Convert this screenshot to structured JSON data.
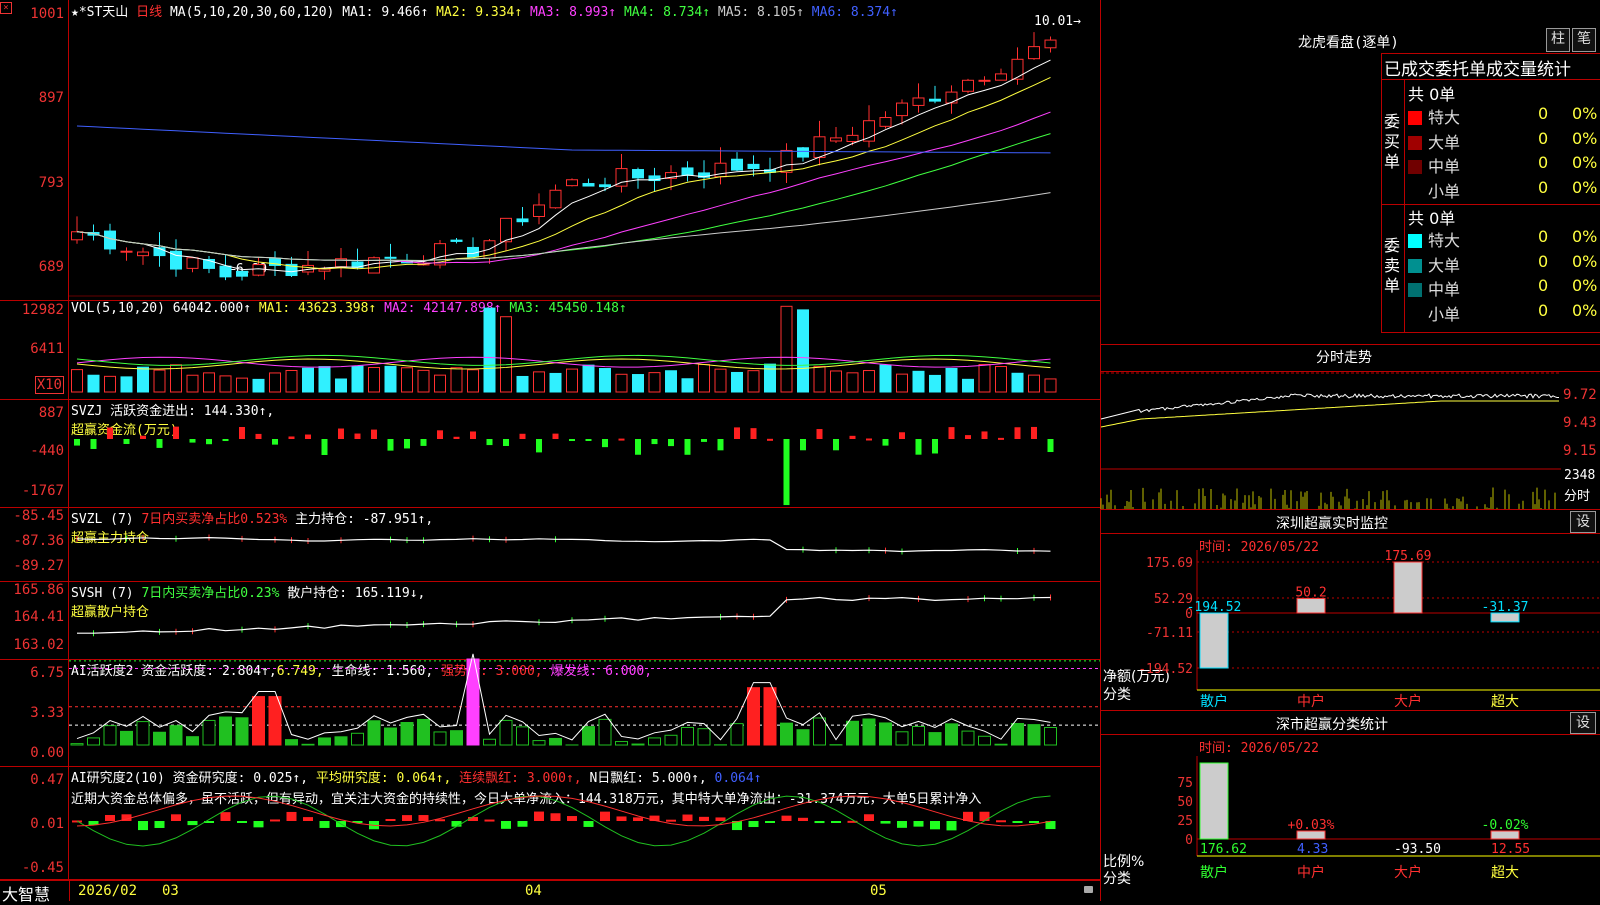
{
  "main": {
    "title_prefix": "★*ST天山",
    "period": "日线",
    "ma_label": "MA(5,10,20,30,60,120)",
    "ma": [
      {
        "label": "MA1: 9.466↑",
        "color": "#ffffff"
      },
      {
        "label": "MA2: 9.334↑",
        "color": "#ffff40"
      },
      {
        "label": "MA3: 8.993↑",
        "color": "#ff40ff"
      },
      {
        "label": "MA4: 8.734↑",
        "color": "#40ff40"
      },
      {
        "label": "MA5: 8.105↑",
        "color": "#cccccc"
      },
      {
        "label": "MA6: 8.374↑",
        "color": "#4060ff"
      }
    ],
    "y_ticks": [
      "1001",
      "897",
      "793",
      "689"
    ],
    "high_note": "10.01→",
    "low_note": "←6.89"
  },
  "vol": {
    "title": "VOL(5,10,20)",
    "value": "64042.000↑",
    "ma1": "MA1: 43623.398↑",
    "ma2": "MA2: 42147.898↑",
    "ma3": "MA3: 45450.148↑",
    "y_ticks": [
      "12982",
      "6411"
    ],
    "unit": "X10"
  },
  "svzj": {
    "title": "SVZJ  活跃资金进出: 144.330↑,",
    "subtitle": "超赢资金流(万元)",
    "y_ticks": [
      "887",
      "-440",
      "-1767"
    ]
  },
  "svzl": {
    "title_a": "SVZL (7) ",
    "title_b": "7日内买卖净占比0.523%",
    "title_c": " 主力持仓: -87.951↑,",
    "subtitle": "超赢主力持仓",
    "y_ticks": [
      "-85.45",
      "-87.36",
      "-89.27"
    ]
  },
  "svsh": {
    "title_a": "SVSH (7) ",
    "title_b": "7日内买卖净占比0.23%",
    "title_c": " 散户持仓: 165.119↓,",
    "subtitle": "超赢散户持仓",
    "y_ticks": [
      "165.86",
      "164.41",
      "163.02"
    ]
  },
  "ai1": {
    "title_a": "AI活跃度2 资金活跃度: 2.804↑,",
    "title_b": "6.749,",
    "title_c": " 生命线: 1.560,",
    "title_d": " 强势线: 3.000,",
    "title_e": " 爆发线: 6.000,",
    "y_ticks": [
      "6.75",
      "3.33",
      "0.00"
    ]
  },
  "ai2": {
    "title_a": "AI研究度2(10) 资金研究度: 0.025↑,",
    "title_b": " 平均研究度: 0.064↑,",
    "title_c": " 连续飘红: 3.000↑,",
    "title_d": " N日飘红: 5.000↑,",
    "title_e": " 0.064↑",
    "note": "近期大资金总体偏多，虽不活跃，但有异动，宜关注大资金的持续性，今日大单净流入：144.318万元，其中特大单净流出：-31.374万元，大单5日累计净入",
    "y_ticks": [
      "0.47",
      "0.01",
      "-0.45"
    ]
  },
  "bottom_bar": {
    "brand": "大智慧",
    "dates": [
      "2026/02",
      "03",
      "04",
      "05"
    ]
  },
  "dragon": {
    "title": "龙虎看盘(逐单)",
    "btn1": "柱",
    "btn2": "笔",
    "header": "已成交委托单成交量统计",
    "buy_label": "委买单",
    "sell_label": "委卖单",
    "buy_total": "共 0单",
    "sell_total": "共 0单",
    "buy_rows": [
      {
        "name": "特大",
        "val": "0",
        "pct": "0%",
        "color": "#ff0000"
      },
      {
        "name": "大单",
        "val": "0",
        "pct": "0%",
        "color": "#a00000"
      },
      {
        "name": "中单",
        "val": "0",
        "pct": "0%",
        "color": "#700000"
      },
      {
        "name": "小单",
        "val": "0",
        "pct": "0%",
        "color": "#000000"
      }
    ],
    "sell_rows": [
      {
        "name": "特大",
        "val": "0",
        "pct": "0%",
        "color": "#00ffff"
      },
      {
        "name": "大单",
        "val": "0",
        "pct": "0%",
        "color": "#009090"
      },
      {
        "name": "中单",
        "val": "0",
        "pct": "0%",
        "color": "#007070"
      },
      {
        "name": "小单",
        "val": "0",
        "pct": "0%",
        "color": "#000000"
      }
    ]
  },
  "intraday": {
    "title": "分时走势",
    "y_ticks": [
      "9.72",
      "9.43",
      "9.15"
    ],
    "vol_tick": "2348",
    "vol_unit": "分时"
  },
  "monitor": {
    "title": "深圳超赢实时监控",
    "btn": "设",
    "time": "时间: 2026/05/22",
    "y_ticks": [
      "175.69",
      "52.29",
      "0",
      "-71.11",
      "-194.52"
    ],
    "axis_title": "净额(万元)",
    "axis_cat": "分类",
    "cats": [
      "散户",
      "中户",
      "大户",
      "超大"
    ],
    "values": [
      -194.52,
      50.2,
      175.69,
      -31.37
    ],
    "labels": [
      "-194.52",
      "50.2",
      "175.69",
      "-31.37"
    ]
  },
  "classify": {
    "title": "深市超赢分类统计",
    "btn": "设",
    "time": "时间: 2026/05/22",
    "y_ticks": [
      "75",
      "50",
      "25",
      "0"
    ],
    "axis_title": "比例%",
    "axis_cat": "分类",
    "cats": [
      "散户",
      "中户",
      "大户",
      "超大"
    ],
    "top_labels": [
      "",
      "+0.03%",
      "",
      "-0.02%"
    ],
    "bottom_values": [
      "176.62",
      "4.33",
      "-93.50",
      "12.55"
    ],
    "pcts": [
      100,
      0.03,
      0,
      0.02
    ]
  }
}
